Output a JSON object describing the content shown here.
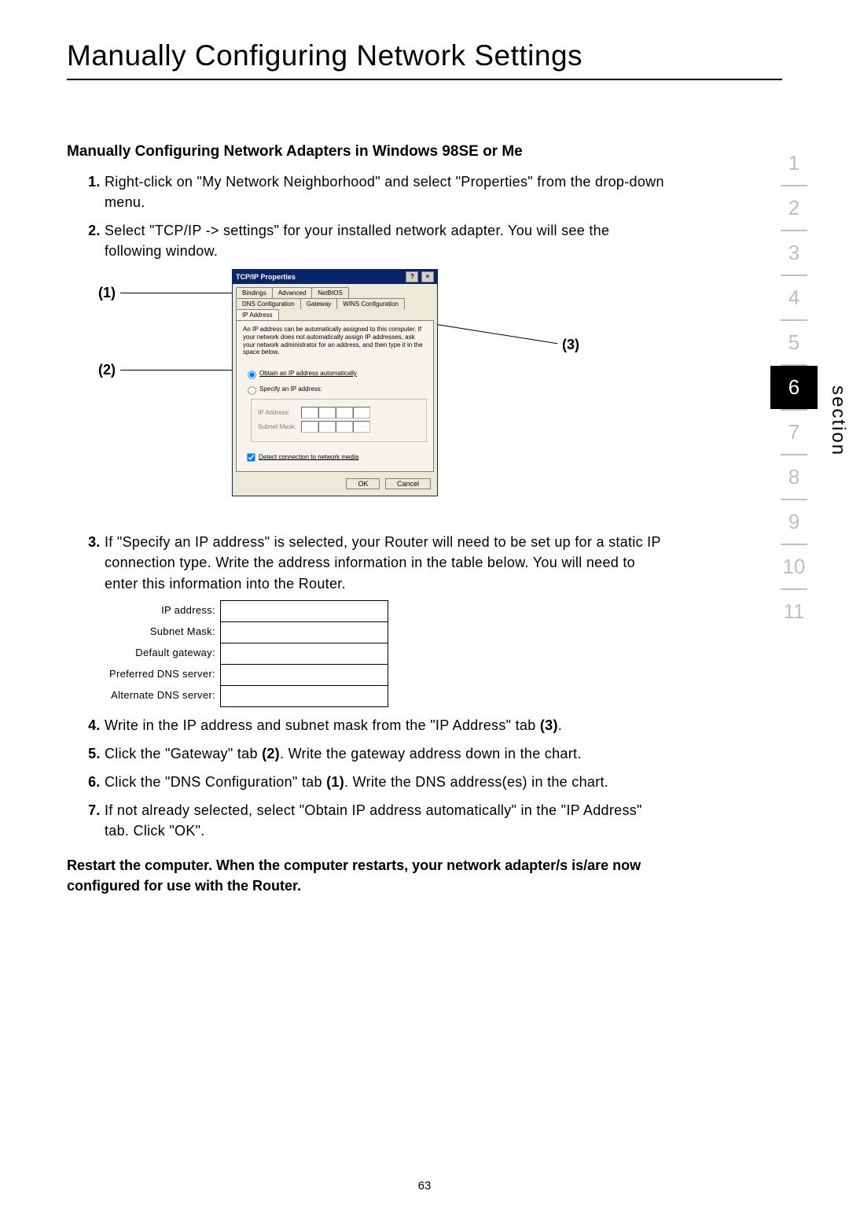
{
  "title": "Manually Configuring Network Settings",
  "subhead": "Manually Configuring Network Adapters in Windows 98SE or Me",
  "steps": {
    "s1": "Right-click on \"My Network Neighborhood\" and select \"Properties\" from the drop-down menu.",
    "s2": "Select \"TCP/IP -> settings\" for your installed network adapter. You will see the following window.",
    "s3": "If \"Specify an IP address\" is selected, your Router will need to be set up for a static IP connection type. Write the address information in the table below. You will need to enter this information into the Router.",
    "s4_a": "Write in the IP address and subnet mask from the \"IP Address\" tab ",
    "s4_b": "(3)",
    "s4_c": ".",
    "s5_a": "Click the \"Gateway\" tab ",
    "s5_b": "(2)",
    "s5_c": ". Write the gateway address down in the chart.",
    "s6_a": "Click the \"DNS Configuration\" tab ",
    "s6_b": "(1)",
    "s6_c": ". Write the DNS address(es) in the chart.",
    "s7": "If not already selected, select \"Obtain IP address automatically\" in the \"IP Address\" tab. Click \"OK\"."
  },
  "restart": "Restart the computer. When the computer restarts, your network adapter/s is/are now configured for use with the Router.",
  "pagenum": "63",
  "sidebar": {
    "section_label": "section",
    "items": [
      "1",
      "2",
      "3",
      "4",
      "5",
      "6",
      "7",
      "8",
      "9",
      "10",
      "11"
    ],
    "active": "6"
  },
  "callouts": {
    "c1": "(1)",
    "c2": "(2)",
    "c3": "(3)"
  },
  "dialog": {
    "title": "TCP/IP Properties",
    "help_btn": "?",
    "close_btn": "×",
    "tabs_row1": [
      "Bindings",
      "Advanced",
      "NetBIOS"
    ],
    "tabs_row2": [
      "DNS Configuration",
      "Gateway",
      "WINS Configuration",
      "IP Address"
    ],
    "active_tab": "IP Address",
    "desc": "An IP address can be automatically assigned to this computer. If your network does not automatically assign IP addresses, ask your network administrator for an address, and then type it in the space below.",
    "radio_auto": "Obtain an IP address automatically",
    "radio_specify": "Specify an IP address:",
    "ip_label": "IP Address:",
    "mask_label": "Subnet Mask:",
    "detect": "Detect connection to network media",
    "ok": "OK",
    "cancel": "Cancel"
  },
  "writein": {
    "ip": "IP address:",
    "mask": "Subnet Mask:",
    "gw": "Default gateway:",
    "pdns": "Preferred DNS server:",
    "adns": "Alternate DNS server:"
  }
}
